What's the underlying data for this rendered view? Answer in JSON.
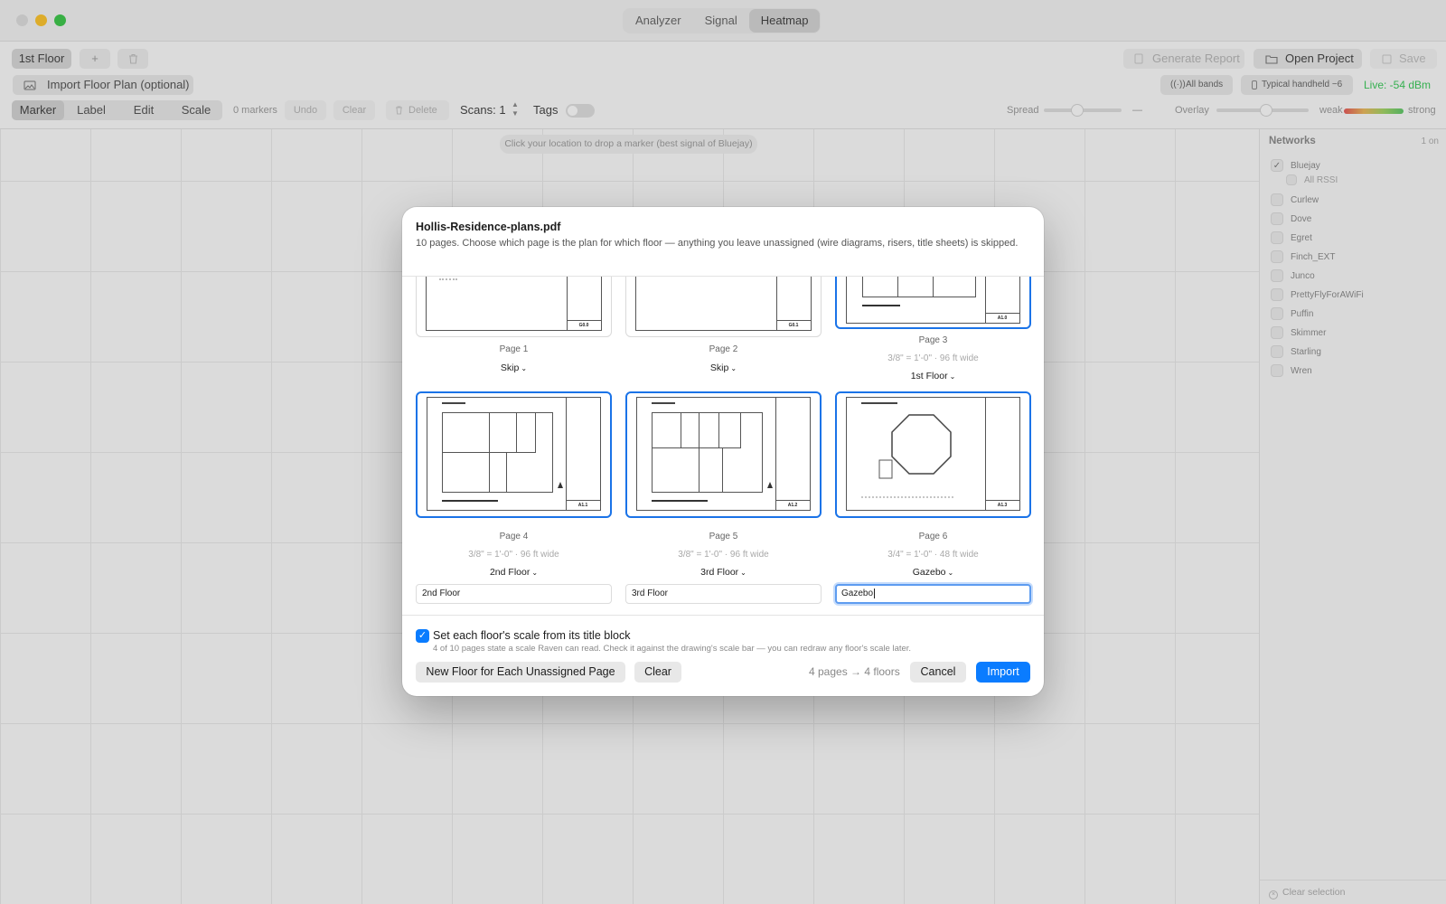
{
  "window": {
    "mode_tabs": [
      "Analyzer",
      "Signal",
      "Heatmap"
    ],
    "selected_mode": "Heatmap"
  },
  "toolbar": {
    "floor_tab": "1st Floor",
    "add_symbol": "+",
    "import_floor_plan": "Import Floor Plan (optional)",
    "generate_report": "Generate Report",
    "open_project": "Open Project",
    "save": "Save",
    "tools": [
      "Marker",
      "Label",
      "Edit",
      "Scale"
    ],
    "selected_tool": "Marker",
    "markers": "0 markers",
    "undo": "Undo",
    "clear": "Clear",
    "delete": "Delete",
    "scans": "Scans: 1",
    "tags": "Tags",
    "all_bands": "All bands",
    "device": "Typical handheld −6",
    "live": "Live: -54 dBm",
    "spread": "Spread",
    "spread_value": "—",
    "overlay": "Overlay",
    "weak": "weak",
    "strong": "strong"
  },
  "canvas": {
    "hint": "Click your location to drop a marker (best signal of Bluejay)"
  },
  "sidebar": {
    "title": "Networks",
    "count": "1 on",
    "networks": [
      {
        "name": "Bluejay",
        "checked": true
      },
      {
        "name": "All RSSI",
        "checked": false,
        "sub": true
      },
      {
        "name": "Curlew",
        "checked": false
      },
      {
        "name": "Dove",
        "checked": false
      },
      {
        "name": "Egret",
        "checked": false
      },
      {
        "name": "Finch_EXT",
        "checked": false
      },
      {
        "name": "Junco",
        "checked": false
      },
      {
        "name": "PrettyFlyForAWiFi",
        "checked": false
      },
      {
        "name": "Puffin",
        "checked": false
      },
      {
        "name": "Skimmer",
        "checked": false
      },
      {
        "name": "Starling",
        "checked": false
      },
      {
        "name": "Wren",
        "checked": false
      }
    ],
    "clear_selection": "Clear selection"
  },
  "dialog": {
    "title": "Hollis-Residence-plans.pdf",
    "subtitle": "10 pages. Choose which page is the plan for which floor — anything you leave unassigned (wire diagrams, risers, title sheets) is skipped.",
    "pages": [
      {
        "label": "Page 1",
        "sheet": "G0.0",
        "assignment": "Skip"
      },
      {
        "label": "Page 2",
        "sheet": "G0.1",
        "assignment": "Skip"
      },
      {
        "label": "Page 3",
        "sheet": "A1.0",
        "scale": "3/8\" = 1'-0\"  ·  96 ft wide",
        "assignment": "1st Floor"
      },
      {
        "label": "Page 4",
        "sheet": "A1.1",
        "scale": "3/8\" = 1'-0\"  ·  96 ft wide",
        "assignment": "2nd Floor",
        "name": "2nd Floor"
      },
      {
        "label": "Page 5",
        "sheet": "A1.2",
        "scale": "3/8\" = 1'-0\"  ·  96 ft wide",
        "assignment": "3rd Floor",
        "name": "3rd Floor"
      },
      {
        "label": "Page 6",
        "sheet": "A1.3",
        "scale": "3/4\" = 1'-0\"  ·  48 ft wide",
        "assignment": "Gazebo",
        "name": "Gazebo"
      }
    ],
    "scale_checkbox_label": "Set each floor's scale from its title block",
    "scale_note": "4 of 10 pages state a scale Raven can read. Check it against the drawing's scale bar — you can redraw any floor's scale later.",
    "new_floor_button": "New Floor for Each Unassigned Page",
    "clear_button": "Clear",
    "summary": "4 pages → 4 floors",
    "cancel_button": "Cancel",
    "import_button": "Import"
  },
  "colors": {
    "accent": "#0a7cff",
    "selection": "#1a73e8",
    "live": "#3cc45a"
  }
}
